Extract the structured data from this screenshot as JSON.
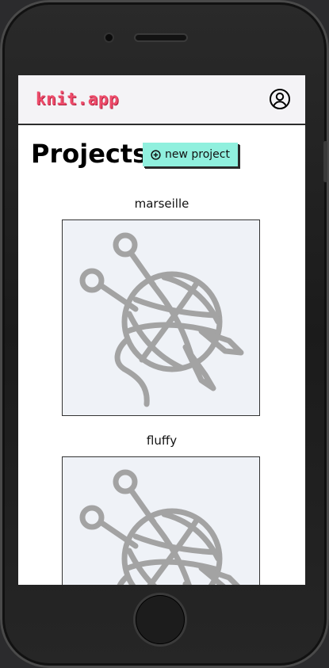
{
  "app": {
    "logo_text": "knit.app",
    "brand_color": "#ee4b6a",
    "accent_color": "#90f0de"
  },
  "header": {
    "profile_icon": "user-circle-icon"
  },
  "main": {
    "title": "Projects",
    "new_project_label": "new project",
    "new_project_icon": "plus-circle-icon"
  },
  "projects": [
    {
      "name": "marseille",
      "image": "yarn-ball-placeholder-icon"
    },
    {
      "name": "fluffy",
      "image": "yarn-ball-placeholder-icon"
    }
  ]
}
